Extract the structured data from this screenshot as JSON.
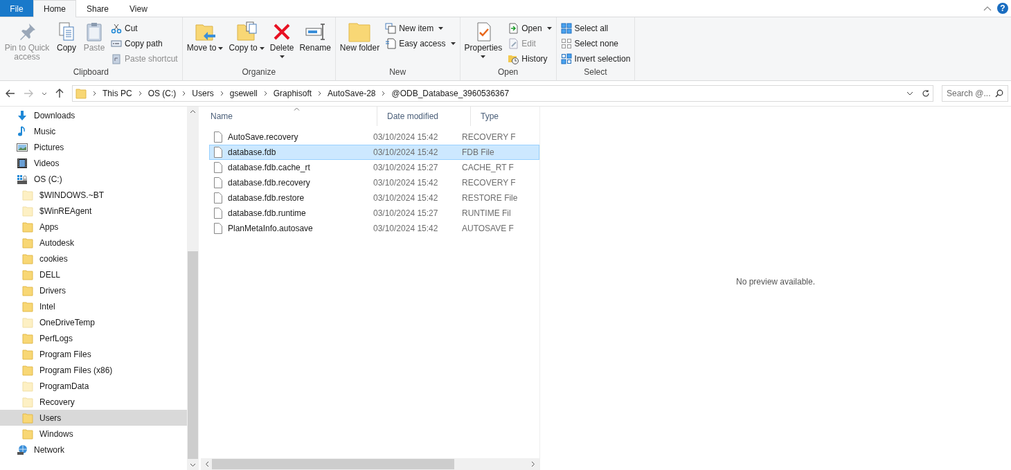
{
  "tabs": [
    {
      "label": "File",
      "kind": "file",
      "selected": false
    },
    {
      "label": "Home",
      "kind": "tab",
      "selected": true
    },
    {
      "label": "Share",
      "kind": "tab",
      "selected": false
    },
    {
      "label": "View",
      "kind": "tab",
      "selected": false
    }
  ],
  "help": "?",
  "ribbon": [
    {
      "label": "Clipboard",
      "columns": [
        [
          {
            "kind": "large",
            "label": "Pin to Quick access",
            "disabled": true
          }
        ],
        [
          {
            "kind": "large",
            "label": "Copy",
            "disabled": false
          }
        ],
        [
          {
            "kind": "large",
            "label": "Paste",
            "disabled": true
          }
        ],
        [
          {
            "kind": "small",
            "label": "Cut",
            "disabled": false
          },
          {
            "kind": "small",
            "label": "Copy path",
            "disabled": false
          },
          {
            "kind": "small",
            "label": "Paste shortcut",
            "disabled": true
          }
        ]
      ]
    },
    {
      "label": "Organize",
      "columns": [
        [
          {
            "kind": "large",
            "label": "Move to",
            "disabled": false,
            "dropdown": true
          }
        ],
        [
          {
            "kind": "large",
            "label": "Copy to",
            "disabled": false,
            "dropdown": true
          }
        ],
        [
          {
            "kind": "split",
            "label": "Delete",
            "disabled": false
          }
        ],
        [
          {
            "kind": "large",
            "label": "Rename",
            "disabled": false
          }
        ]
      ]
    },
    {
      "label": "New",
      "columns": [
        [
          {
            "kind": "large",
            "label": "New folder",
            "disabled": false
          }
        ],
        [
          {
            "kind": "small",
            "label": "New item",
            "disabled": false,
            "dropdown": true
          },
          {
            "kind": "small",
            "label": "Easy access",
            "disabled": false,
            "dropdown": true
          }
        ]
      ]
    },
    {
      "label": "Open",
      "columns": [
        [
          {
            "kind": "split",
            "label": "Properties",
            "disabled": false
          }
        ],
        [
          {
            "kind": "small",
            "label": "Open",
            "disabled": false,
            "dropdown": true
          },
          {
            "kind": "small",
            "label": "Edit",
            "disabled": true
          },
          {
            "kind": "small",
            "label": "History",
            "disabled": false
          }
        ]
      ]
    },
    {
      "label": "Select",
      "columns": [
        [
          {
            "kind": "small",
            "label": "Select all",
            "disabled": false
          },
          {
            "kind": "small",
            "label": "Select none",
            "disabled": false
          },
          {
            "kind": "small",
            "label": "Invert selection",
            "disabled": false
          }
        ]
      ]
    }
  ],
  "address": {
    "path": [
      "This PC",
      "OS (C:)",
      "Users",
      "gsewell",
      "Graphisoft",
      "AutoSave-28",
      "@ODB_Database_3960536367"
    ],
    "forward_disabled": true
  },
  "search": {
    "placeholder": "Search @..."
  },
  "sidebar": {
    "items": [
      {
        "label": "Downloads",
        "kind": "downloads",
        "selected": false
      },
      {
        "label": "Music",
        "kind": "music",
        "selected": false
      },
      {
        "label": "Pictures",
        "kind": "pictures",
        "selected": false
      },
      {
        "label": "Videos",
        "kind": "videos",
        "selected": false
      },
      {
        "label": "OS (C:)",
        "kind": "drive",
        "selected": false,
        "children": [
          {
            "label": "$WINDOWS.~BT",
            "kind": "folder",
            "hidden": true,
            "selected": false
          },
          {
            "label": "$WinREAgent",
            "kind": "folder",
            "hidden": true,
            "selected": false
          },
          {
            "label": "Apps",
            "kind": "folder",
            "hidden": false,
            "selected": false
          },
          {
            "label": "Autodesk",
            "kind": "folder",
            "hidden": false,
            "selected": false
          },
          {
            "label": "cookies",
            "kind": "folder",
            "hidden": false,
            "selected": false
          },
          {
            "label": "DELL",
            "kind": "folder",
            "hidden": false,
            "selected": false
          },
          {
            "label": "Drivers",
            "kind": "folder",
            "hidden": false,
            "selected": false
          },
          {
            "label": "Intel",
            "kind": "folder",
            "hidden": false,
            "selected": false
          },
          {
            "label": "OneDriveTemp",
            "kind": "folder",
            "hidden": true,
            "selected": false
          },
          {
            "label": "PerfLogs",
            "kind": "folder",
            "hidden": false,
            "selected": false
          },
          {
            "label": "Program Files",
            "kind": "folder",
            "hidden": false,
            "selected": false
          },
          {
            "label": "Program Files (x86)",
            "kind": "folder",
            "hidden": false,
            "selected": false
          },
          {
            "label": "ProgramData",
            "kind": "folder",
            "hidden": true,
            "selected": false
          },
          {
            "label": "Recovery",
            "kind": "folder",
            "hidden": true,
            "selected": false
          },
          {
            "label": "Users",
            "kind": "folder",
            "hidden": false,
            "selected": true
          },
          {
            "label": "Windows",
            "kind": "folder",
            "hidden": false,
            "selected": false
          }
        ]
      },
      {
        "label": "Network",
        "kind": "network",
        "selected": false
      }
    ]
  },
  "table": {
    "columns": [
      "Name",
      "Date modified",
      "Type"
    ],
    "rows": [
      {
        "name": "AutoSave.recovery",
        "date": "03/10/2024 15:42",
        "type": "RECOVERY F",
        "selected": false
      },
      {
        "name": "database.fdb",
        "date": "03/10/2024 15:42",
        "type": "FDB File",
        "selected": true
      },
      {
        "name": "database.fdb.cache_rt",
        "date": "03/10/2024 15:27",
        "type": "CACHE_RT F",
        "selected": false
      },
      {
        "name": "database.fdb.recovery",
        "date": "03/10/2024 15:42",
        "type": "RECOVERY F",
        "selected": false
      },
      {
        "name": "database.fdb.restore",
        "date": "03/10/2024 15:42",
        "type": "RESTORE File",
        "selected": false
      },
      {
        "name": "database.fdb.runtime",
        "date": "03/10/2024 15:27",
        "type": "RUNTIME Fil",
        "selected": false
      },
      {
        "name": "PlanMetaInfo.autosave",
        "date": "03/10/2024 15:42",
        "type": "AUTOSAVE F",
        "selected": false
      }
    ]
  },
  "preview": {
    "message": "No preview available."
  }
}
